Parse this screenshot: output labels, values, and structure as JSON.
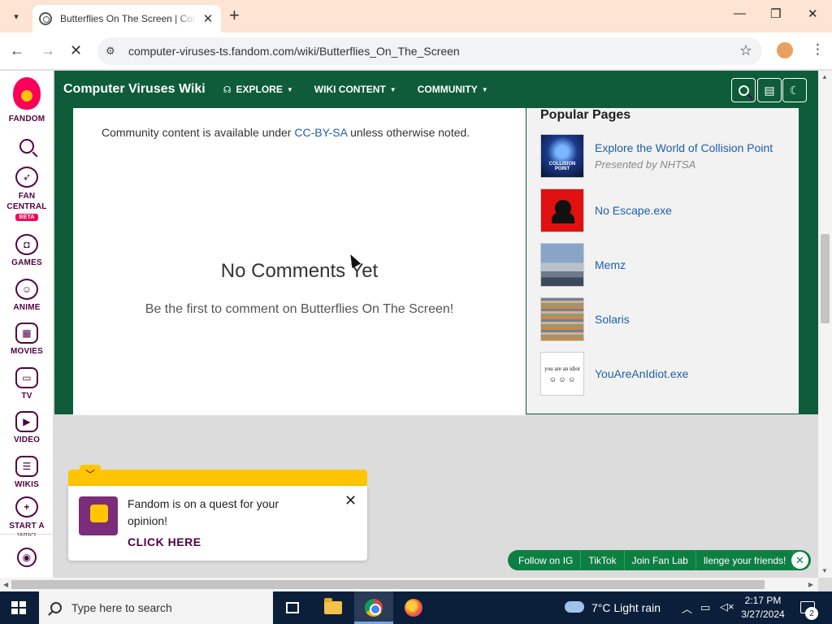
{
  "browser": {
    "tab_title": "Butterflies On The Screen | Computer Viruses Wiki | Fandom",
    "url": "computer-viruses-ts.fandom.com/wiki/Butterflies_On_The_Screen",
    "new_tab": "+",
    "tab_close": "✕",
    "minimize": "—",
    "maximize": "❐",
    "close": "✕"
  },
  "rail": {
    "logo_label": "FANDOM",
    "items": [
      {
        "label": "FAN CENTRAL",
        "badge": "BETA",
        "icon": "rocket-icon"
      },
      {
        "label": "GAMES",
        "icon": "gamepad-icon"
      },
      {
        "label": "ANIME",
        "icon": "anime-face-icon"
      },
      {
        "label": "MOVIES",
        "icon": "clapper-icon"
      },
      {
        "label": "TV",
        "icon": "tv-icon"
      },
      {
        "label": "VIDEO",
        "icon": "play-icon"
      },
      {
        "label": "WIKIS",
        "icon": "book-icon"
      },
      {
        "label": "START A WIKI",
        "icon": "plus-icon"
      }
    ]
  },
  "wiki": {
    "name": "Computer Viruses Wiki",
    "nav": [
      "EXPLORE",
      "WIKI CONTENT",
      "COMMUNITY"
    ],
    "accent": "#0e5c3a"
  },
  "main": {
    "license_prefix": "Community content is available under ",
    "license_link": "CC-BY-SA",
    "license_suffix": " unless otherwise noted.",
    "comments_title": "No Comments Yet",
    "comments_sub": "Be the first to comment on Butterflies On The Screen!"
  },
  "popular": {
    "title": "Popular Pages",
    "items": [
      {
        "name": "Explore the World of Collision Point",
        "sponsor": "Presented by NHTSA",
        "thumb_text": "COLLISION POINT"
      },
      {
        "name": "No Escape.exe"
      },
      {
        "name": "Memz"
      },
      {
        "name": "Solaris"
      },
      {
        "name": "YouAreAnIdiot.exe",
        "thumb_text": "you are an idiot"
      }
    ]
  },
  "popup": {
    "text": "Fandom is on a quest for your opinion!",
    "cta": "CLICK HERE"
  },
  "followbar": {
    "buttons": [
      "Follow on IG",
      "TikTok",
      "Join Fan Lab",
      "llenge your friends!"
    ]
  },
  "taskbar": {
    "search_placeholder": "Type here to search",
    "weather": "7°C  Light rain",
    "time": "2:17 PM",
    "date": "3/27/2024",
    "notifications": "2"
  }
}
